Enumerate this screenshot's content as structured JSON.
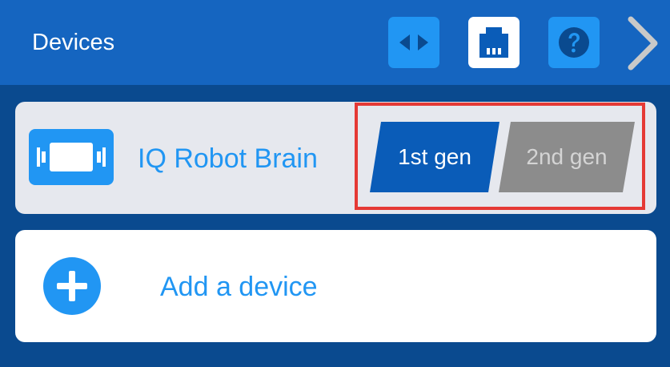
{
  "header": {
    "title": "Devices",
    "buttons": [
      {
        "icon": "code-icon"
      },
      {
        "icon": "port-icon"
      },
      {
        "icon": "help-icon"
      },
      {
        "icon": "chevron-right-icon"
      }
    ]
  },
  "device": {
    "icon": "robot-brain-icon",
    "name": "IQ Robot Brain",
    "generations": [
      "1st gen",
      "2nd gen"
    ],
    "selected": "1st gen"
  },
  "add_device": {
    "icon": "plus-icon",
    "label": "Add a device"
  },
  "colors": {
    "header": "#1565c0",
    "background": "#0a4a8f",
    "accent": "#2196f3",
    "selected_gen": "#0a5cb8",
    "unselected_gen": "#8c8c8c",
    "highlight": "#e53935"
  }
}
